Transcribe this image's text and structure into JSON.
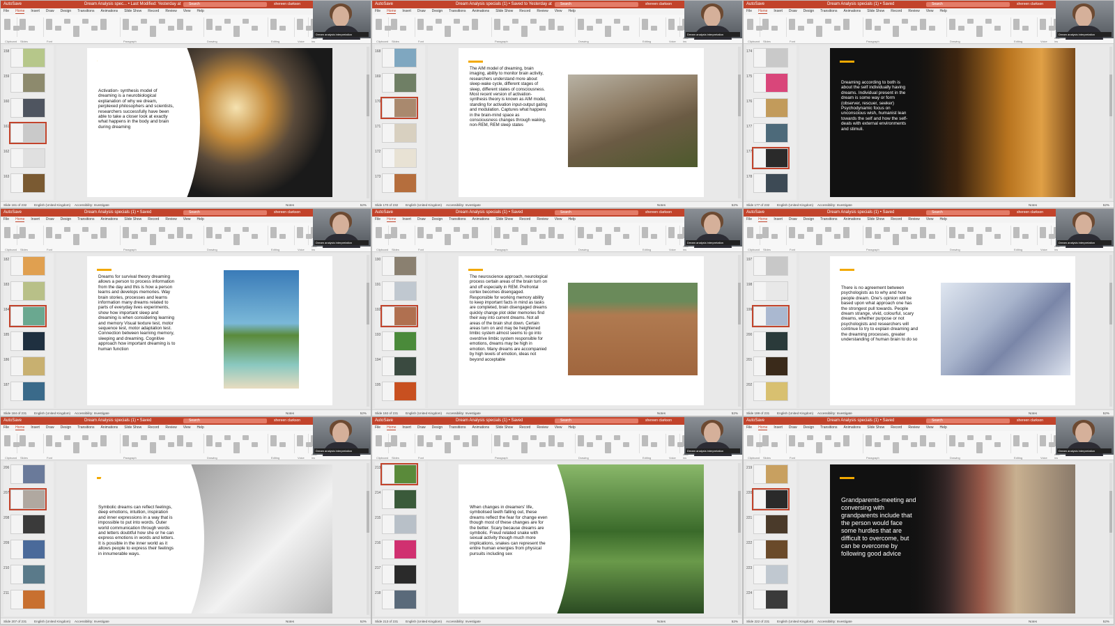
{
  "common": {
    "autosave": "AutoSave",
    "search": "Search",
    "user": "shereen clarkson",
    "caption": "Dream analysis interpretation",
    "menu": [
      "File",
      "Home",
      "Insert",
      "Draw",
      "Design",
      "Transitions",
      "Animations",
      "Slide Show",
      "Record",
      "Review",
      "View",
      "Help"
    ],
    "groups": [
      "Clipboard",
      "Slides",
      "Font",
      "Paragraph",
      "Drawing",
      "Editing",
      "Voice",
      "Add-ins"
    ],
    "language": "English (United Kingdom)",
    "accessibility": "Accessibility: Investigate",
    "notes": "Notes",
    "zoom": "52%"
  },
  "windows": [
    {
      "file": "Dream Analysis spec... • Last Modified: Yesterday at 15:57",
      "slide_status": "Slide 161 of 232",
      "thumbs": [
        {
          "n": "158",
          "c": "#b6c78a"
        },
        {
          "n": "159",
          "c": "#8d8a6d"
        },
        {
          "n": "160",
          "c": "#4f5560"
        },
        {
          "n": "161",
          "c": "#c9c9c9",
          "sel": true
        },
        {
          "n": "162",
          "c": "#e0e0e0"
        },
        {
          "n": "163",
          "c": "#7a5a32"
        }
      ],
      "layout": "left-text-right-image",
      "dark": false,
      "text": "Activation- synthesis model of dreaming is a neurobiological explanation of why we dream, perplexed philosophers and scientists, researchers successfully have been able to take a closer look at exactly what happens in the body and brain during dreaming",
      "image": {
        "name": "dancers-silhouette-image",
        "bg": "radial-gradient(circle at 40% 40%, #f5e2b0 0%, #c38a3b 25%, #5a4a3a 45%, #1a1a1a 70%)"
      }
    },
    {
      "file": "Dream Analysis specials (1) • Saved to Yesterday at 15:57",
      "slide_status": "Slide 170 of 232",
      "thumbs": [
        {
          "n": "168",
          "c": "#7fa7c0"
        },
        {
          "n": "169",
          "c": "#6f7f65"
        },
        {
          "n": "170",
          "c": "#a9896e",
          "sel": true
        },
        {
          "n": "171",
          "c": "#d8d0c0"
        },
        {
          "n": "172",
          "c": "#e8e2d4"
        },
        {
          "n": "173",
          "c": "#b56e3d"
        }
      ],
      "layout": "left-text-right-image",
      "dark": false,
      "text": "The AIM model of dreaming, brain imaging, ability to monitor brain activity, researchers understand more about sleep-wake cycle, different stages of sleep, different states of consciousness. Most recent version of activation-synthesis theory is known as AIM model, standing for activation input-output gating and modulation. Captures what happens in the brain-mind space as consciousness changes through waking, non-REM, REM  sleep states",
      "image": {
        "name": "pug-puppy-image",
        "bg": "linear-gradient(160deg,#b8b2a4 0%,#8c7a62 40%,#6b5b44 60%,#4d5a2c 100%)"
      }
    },
    {
      "file": "Dream Analysis specials (1) • Saved",
      "slide_status": "Slide 177 of 232",
      "thumbs": [
        {
          "n": "174",
          "c": "#c9c9c9"
        },
        {
          "n": "175",
          "c": "#d9467a"
        },
        {
          "n": "176",
          "c": "#c29b5b"
        },
        {
          "n": "177",
          "c": "#4d6a7a"
        },
        {
          "n": "177",
          "c": "#2a2a2a",
          "sel": true
        },
        {
          "n": "178",
          "c": "#3d4a55"
        }
      ],
      "layout": "dark-full",
      "dark": true,
      "text": "Dreaming according to both is about the self individually having dreams. Individual present in the dream is some way or form (observer, rescuer, seeker) Psychodynamic focus on unconscious wish, humanist lean towards the self and how the self-deals with external environments and stimuli.",
      "image": {
        "name": "beach-sunset-children-image",
        "bg": "linear-gradient(90deg,#111 0%,#3a230f 30%,#b8741f 60%,#e0a046 80%,#7a4a1a 100%)"
      }
    },
    {
      "file": "Dream Analysis specials (1) • Saved",
      "slide_status": "Slide 184 of 231",
      "thumbs": [
        {
          "n": "182",
          "c": "#e0a050"
        },
        {
          "n": "183",
          "c": "#b8c088"
        },
        {
          "n": "184",
          "c": "#6aa890",
          "sel": true
        },
        {
          "n": "185",
          "c": "#1f3040"
        },
        {
          "n": "186",
          "c": "#c8b070"
        },
        {
          "n": "187",
          "c": "#3a6a8a"
        }
      ],
      "layout": "left-text-right-image",
      "dark": false,
      "text": "Dreams for survival theory dreaming allows a person to process information from the day and this is how a person learns and develops memories. Way brain stories, processes and learns information many dreams related to parts of everyday lives experiments, show how important sleep and dreaming is when considering learning and memory Visual texture test, motor sequence test, motor adaptation test. Connection between learning memory, sleeping and dreaming. Cognitive approach how important dreaming is to human function",
      "image": {
        "name": "palm-tree-beach-image",
        "bg": "linear-gradient(180deg,#3a7bb8 0%,#7ab8d8 45%,#5a8a3a 55%,#8ac8c0 80%,#e8dcc0 100%)"
      }
    },
    {
      "file": "Dream Analysis specials (1) • Saved",
      "slide_status": "Slide 192 of 231",
      "thumbs": [
        {
          "n": "190",
          "c": "#8a8070"
        },
        {
          "n": "191",
          "c": "#c0c8d0"
        },
        {
          "n": "192",
          "c": "#b07050",
          "sel": true
        },
        {
          "n": "193",
          "c": "#4a8a3a"
        },
        {
          "n": "194",
          "c": "#3a4a40"
        },
        {
          "n": "195",
          "c": "#c85020"
        }
      ],
      "layout": "left-text-right-image",
      "dark": false,
      "text": "The neuroscience approach, neurological process  certain areas of the brain turn on and off especially in REM. Prefrontal cortex becomes disengaged. Responsible for working memory ability to keep important facts in mind as  tasks are completed, brain disengaged dreams quickly change plot older memories find their way into current dreams. Not all areas of the brain shut down. Certain areas turn on and may be heightened  limbic system almost seems to go into overdrive limbic system responsible for emotions, dreams may be high in emotion. Many dreams are accompanied by high levels of emotion, ideas not beyond acceptable",
      "image": {
        "name": "baseball-on-field-image",
        "bg": "linear-gradient(180deg,#6a8a5a 0%,#6a8a5a 20%,#b07a50 35%,#a0663e 100%)"
      }
    },
    {
      "file": "Dream Analysis specials (1) • Saved",
      "slide_status": "Slide 199 of 231",
      "thumbs": [
        {
          "n": "197",
          "c": "#c8c8c8"
        },
        {
          "n": "198",
          "c": "#e8e8e8"
        },
        {
          "n": "199",
          "c": "#aab8d0",
          "sel": true
        },
        {
          "n": "200",
          "c": "#2a3a3a"
        },
        {
          "n": "201",
          "c": "#3a2a1a"
        },
        {
          "n": "202",
          "c": "#d8c070"
        }
      ],
      "layout": "left-text-right-image",
      "dark": false,
      "text": "There is no agreement between psychologists as to why and how people dream. One's opinion will be based upon what approach one has the strongest pull towards. People dream strange, vivid, colourful, scary dreams, whether purpose or not psychologists and researchers will continue to try to explain dreaming and the dreaming processes, greater understanding of human brain to do so",
      "image": {
        "name": "frosty-trees-image",
        "bg": "linear-gradient(135deg,#dfe6f0 0%,#a8b4cc 40%,#7a86a8 60%,#dce2ee 100%)"
      }
    },
    {
      "file": "Dream Analysis specials (1) • Saved",
      "slide_status": "Slide 207 of 231",
      "thumbs": [
        {
          "n": "206",
          "c": "#6a7a9a"
        },
        {
          "n": "207",
          "c": "#b0a8a0",
          "sel": true
        },
        {
          "n": "208",
          "c": "#3a3a3a"
        },
        {
          "n": "209",
          "c": "#4a6a9a"
        },
        {
          "n": "210",
          "c": "#5a7a8a"
        },
        {
          "n": "211",
          "c": "#c87030"
        }
      ],
      "layout": "left-text-right-image",
      "dark": false,
      "text": "Symbolic dreams can reflect feelings, deep emotions, intuition, inspiration and inner expressions in a way that is impossible to put into words. Outer world communication through words and letters doubtful how she or he can express emotions in words and letters. It is possible in the inner world as it allows people to express their feelings in innumerable ways.",
      "image": {
        "name": "red-bird-branch-image",
        "bg": "linear-gradient(135deg,#9a9a9a 0%,#d0d0d0 40%,#f2f2f2 60%,#b8b8b8 100%)"
      }
    },
    {
      "file": "Dream Analysis specials (1) • Saved",
      "slide_status": "Slide 213 of 231",
      "thumbs": [
        {
          "n": "213",
          "c": "#5a8a3a",
          "sel": true
        },
        {
          "n": "214",
          "c": "#3a5a3a"
        },
        {
          "n": "215",
          "c": "#b8c0c8"
        },
        {
          "n": "216",
          "c": "#d03070"
        },
        {
          "n": "217",
          "c": "#2a2a2a"
        },
        {
          "n": "218",
          "c": "#5a6a7a"
        }
      ],
      "layout": "left-text-right-image",
      "dark": false,
      "text": "When changes in dreamers' life, symbolised teeth falling out, these dreams reflect the fear for change even though most of these changes are for the better. Scary because dreams are symbolic. Freud related snake with sexual activity though much more implications, snakes can represent the entire human energies from physical pursuits including sex",
      "image": {
        "name": "garden-gazebo-image",
        "bg": "linear-gradient(180deg,#8ab86a 0%,#3a6a2a 45%,#6a9a4a 65%,#2a4a22 100%)"
      }
    },
    {
      "file": "Dream Analysis specials (1) • Saved",
      "slide_status": "Slide 222 of 231",
      "thumbs": [
        {
          "n": "219",
          "c": "#c8a060"
        },
        {
          "n": "220",
          "c": "#2a2a2a",
          "sel": true
        },
        {
          "n": "221",
          "c": "#4a3a2a"
        },
        {
          "n": "222",
          "c": "#6a4a2a"
        },
        {
          "n": "223",
          "c": "#c0c8d0"
        },
        {
          "n": "224",
          "c": "#3a3a3a"
        }
      ],
      "layout": "dark-full",
      "dark": true,
      "text": "Grandparents-meeting and conversing with grandparents include that the person would face some hurdles that are difficult to overcome, but can be overcome by following good advice",
      "big_text": true,
      "image": {
        "name": "elderly-couple-harbour-image",
        "bg": "linear-gradient(90deg,#111 0%,#3a2a2a 25%,#9a5a4a 45%,#c8b090 65%,#8a7a6a 100%)"
      }
    }
  ]
}
